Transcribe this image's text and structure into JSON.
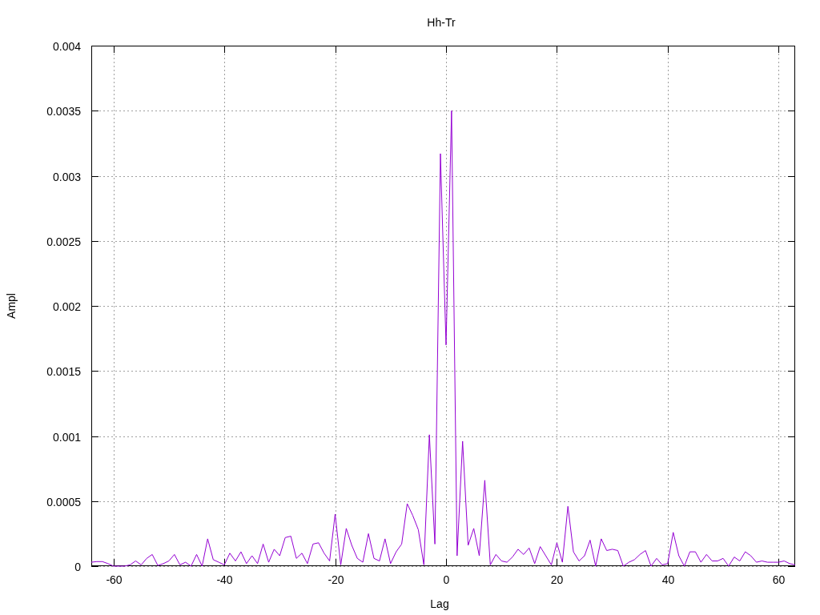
{
  "chart": {
    "chart_data": {
      "type": "line",
      "title": "Hh-Tr",
      "xlabel": "Lag",
      "ylabel": "Ampl",
      "x": [
        -64,
        -63,
        -62,
        -61,
        -60,
        -59,
        -58,
        -57,
        -56,
        -55,
        -54,
        -53,
        -52,
        -51,
        -50,
        -49,
        -48,
        -47,
        -46,
        -45,
        -44,
        -43,
        -42,
        -41,
        -40,
        -39,
        -38,
        -37,
        -36,
        -35,
        -34,
        -33,
        -32,
        -31,
        -30,
        -29,
        -28,
        -27,
        -26,
        -25,
        -24,
        -23,
        -22,
        -21,
        -20,
        -19,
        -18,
        -17,
        -16,
        -15,
        -14,
        -13,
        -12,
        -11,
        -10,
        -9,
        -8,
        -7,
        -6,
        -5,
        -4,
        -3,
        -2,
        -1,
        0,
        1,
        2,
        3,
        4,
        5,
        6,
        7,
        8,
        9,
        10,
        11,
        12,
        13,
        14,
        15,
        16,
        17,
        18,
        19,
        20,
        21,
        22,
        23,
        24,
        25,
        26,
        27,
        28,
        29,
        30,
        31,
        32,
        33,
        34,
        35,
        36,
        37,
        38,
        39,
        40,
        41,
        42,
        43,
        44,
        45,
        46,
        47,
        48,
        49,
        50,
        51,
        52,
        53,
        54,
        55,
        56,
        57,
        58,
        59,
        60,
        61,
        62,
        63
      ],
      "series": [
        {
          "color": "#9400d3",
          "values": [
            3e-05,
            3.5e-05,
            3.5e-05,
            2e-05,
            0,
            0,
            0,
            1e-05,
            4e-05,
            1e-05,
            6e-05,
            9e-05,
            5e-06,
            2e-05,
            4e-05,
            9e-05,
            1e-05,
            3e-05,
            0,
            9e-05,
            0,
            0.00021,
            5e-05,
            3e-05,
            1e-05,
            0.0001,
            4e-05,
            0.00011,
            2e-05,
            8e-05,
            2e-05,
            0.00017,
            3e-05,
            0.00013,
            8e-05,
            0.00022,
            0.00023,
            6e-05,
            0.0001,
            2e-05,
            0.00017,
            0.00018,
            0.0001,
            4e-05,
            0.0004,
            1e-05,
            0.00029,
            0.00016,
            6e-05,
            3e-05,
            0.00025,
            6e-05,
            4e-05,
            0.00021,
            2e-05,
            0.00011,
            0.00017,
            0.00048,
            0.00039,
            0.00028,
            1e-05,
            0.00101,
            0.00017,
            0.00317,
            0.0017,
            0.0035,
            8e-05,
            0.00096,
            0.00016,
            0.00029,
            8e-05,
            0.00066,
            1e-05,
            9e-05,
            4e-05,
            3e-05,
            7e-05,
            0.00013,
            9e-05,
            0.00014,
            2e-05,
            0.00015,
            8e-05,
            1e-05,
            0.00018,
            3e-05,
            0.00046,
            0.00011,
            4e-05,
            8e-05,
            0.0002,
            0,
            0.00021,
            0.00012,
            0.00013,
            0.00012,
            0,
            3e-05,
            5e-05,
            9e-05,
            0.00012,
            0,
            6e-05,
            1e-05,
            2e-05,
            0.00026,
            8e-05,
            0,
            0.00011,
            0.00011,
            3e-05,
            9e-05,
            4e-05,
            4e-05,
            6e-05,
            0,
            7e-05,
            4e-05,
            0.00011,
            8e-05,
            3e-05,
            4e-05,
            3e-05,
            3e-05,
            3e-05,
            4e-05,
            2e-05,
            1e-05
          ]
        }
      ],
      "grid": true,
      "xlim": [
        -64,
        63
      ],
      "ylim": [
        0,
        0.004
      ],
      "xticks": [
        -60,
        -40,
        -20,
        0,
        20,
        40,
        60
      ],
      "yticks": [
        0,
        0.0005,
        0.001,
        0.0015,
        0.002,
        0.0025,
        0.003,
        0.0035,
        0.004
      ]
    }
  }
}
